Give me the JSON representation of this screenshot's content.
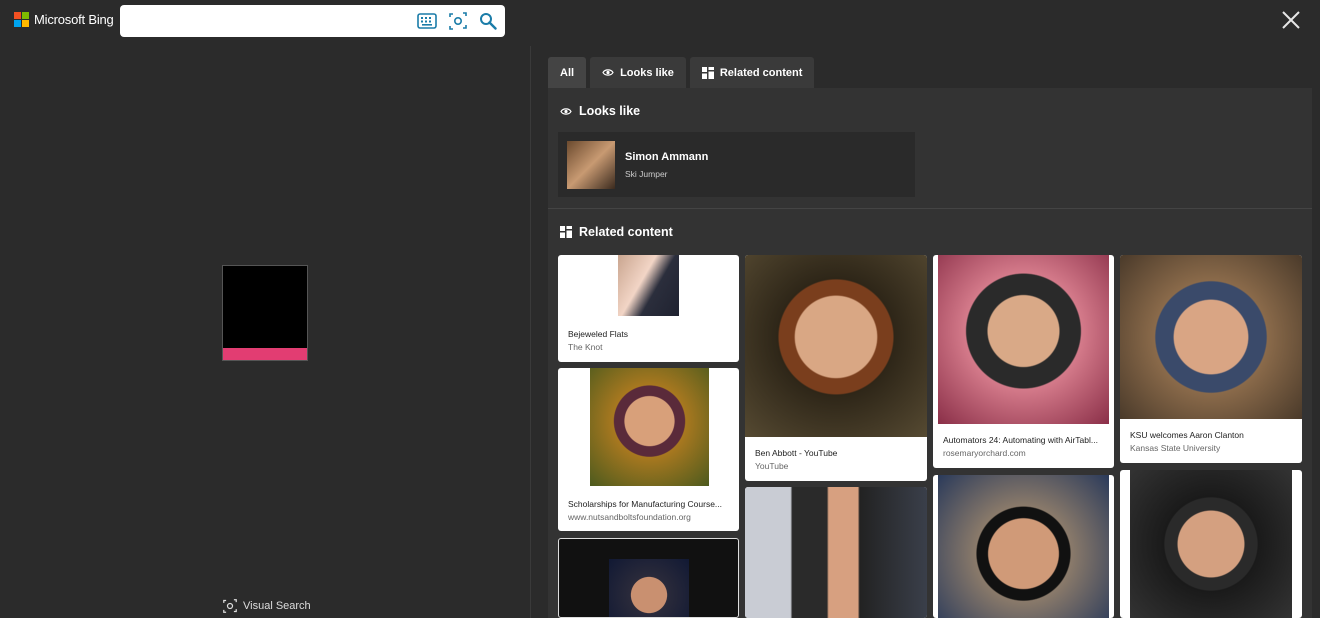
{
  "header": {
    "brand": "Microsoft Bing",
    "search_value": "",
    "search_placeholder": "",
    "icons": [
      "keyboard-icon",
      "visual-search-icon",
      "search-icon",
      "close-icon"
    ]
  },
  "left": {
    "visual_search_label": "Visual Search"
  },
  "tabs": [
    {
      "label": "All",
      "icon": ""
    },
    {
      "label": "Looks like",
      "icon": "eye-icon"
    },
    {
      "label": "Related content",
      "icon": "grid-icon"
    }
  ],
  "looks_like": {
    "title": "Looks like",
    "person": {
      "name": "Simon Ammann",
      "subtitle": "Ski Jumper"
    }
  },
  "related": {
    "title": "Related content",
    "cards": [
      {
        "caption": "Bejeweled Flats",
        "source": "The Knot"
      },
      {
        "caption": "Scholarships for Manufacturing Course...",
        "source": "www.nutsandboltsfoundation.org"
      },
      {
        "caption": "",
        "source": ""
      },
      {
        "caption": "Ben Abbott - YouTube",
        "source": "YouTube"
      },
      {
        "caption": "",
        "source": ""
      },
      {
        "caption": "Automators 24: Automating with AirTabl...",
        "source": "rosemaryorchard.com"
      },
      {
        "caption": "",
        "source": ""
      },
      {
        "caption": "KSU welcomes Aaron Clanton",
        "source": "Kansas State University"
      },
      {
        "caption": "",
        "source": ""
      }
    ]
  },
  "colors": {
    "background": "#2b2b2b",
    "panel": "#333333",
    "accent_pink": "#e23d72"
  }
}
